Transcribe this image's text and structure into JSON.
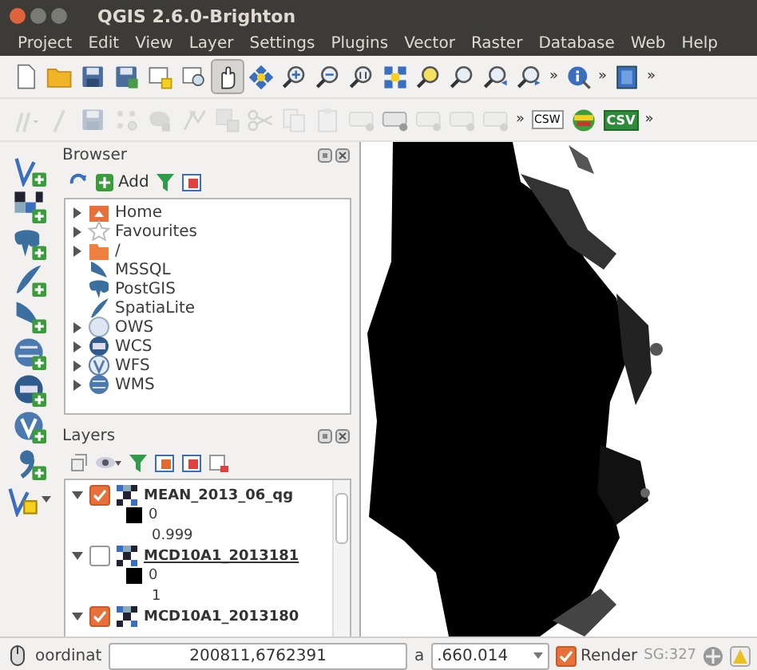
{
  "window": {
    "title": "QGIS 2.6.0-Brighton"
  },
  "menu": [
    "Project",
    "Edit",
    "View",
    "Layer",
    "Settings",
    "Plugins",
    "Vector",
    "Raster",
    "Database",
    "Web",
    "Help"
  ],
  "toolbar_1": [
    {
      "kind": "new",
      "pressed": false
    },
    {
      "kind": "open",
      "pressed": false
    },
    {
      "kind": "save",
      "pressed": false
    },
    {
      "kind": "saveas",
      "pressed": false
    },
    {
      "kind": "composer",
      "pressed": false
    },
    {
      "kind": "composer-manager",
      "pressed": false
    },
    {
      "kind": "pan",
      "pressed": true
    },
    {
      "kind": "pan-selection",
      "pressed": false
    },
    {
      "kind": "zoom-in",
      "pressed": false
    },
    {
      "kind": "zoom-out",
      "pressed": false
    },
    {
      "kind": "zoom-native",
      "pressed": false
    },
    {
      "kind": "zoom-full",
      "pressed": false
    },
    {
      "kind": "zoom-layer",
      "pressed": false
    },
    {
      "kind": "zoom-selection",
      "pressed": false
    },
    {
      "kind": "zoom-last",
      "pressed": false
    },
    {
      "kind": "zoom-next",
      "pressed": false
    },
    {
      "kind": "more",
      "label": "»"
    },
    {
      "kind": "identify",
      "pressed": false
    },
    {
      "kind": "more",
      "label": "»"
    },
    {
      "kind": "help",
      "pressed": false
    },
    {
      "kind": "more",
      "label": "»"
    }
  ],
  "toolbar_2": [
    {
      "kind": "edits",
      "disabled": true
    },
    {
      "kind": "edit",
      "disabled": true
    },
    {
      "kind": "save",
      "disabled": true
    },
    {
      "kind": "add-point",
      "disabled": true
    },
    {
      "kind": "add-feature",
      "disabled": true
    },
    {
      "kind": "node",
      "disabled": true
    },
    {
      "kind": "delete",
      "disabled": true
    },
    {
      "kind": "cut",
      "disabled": true
    },
    {
      "kind": "copy",
      "disabled": true
    },
    {
      "kind": "paste",
      "disabled": true
    },
    {
      "kind": "label",
      "disabled": true
    },
    {
      "kind": "label",
      "disabled": false
    },
    {
      "kind": "label",
      "disabled": true
    },
    {
      "kind": "label",
      "disabled": true
    },
    {
      "kind": "label",
      "disabled": true
    },
    {
      "kind": "more",
      "label": "»"
    },
    {
      "kind": "csw",
      "label": "CSW",
      "disabled": false
    },
    {
      "kind": "plugin",
      "disabled": false
    },
    {
      "kind": "csv",
      "label": "CSV",
      "disabled": false
    },
    {
      "kind": "more",
      "label": "»"
    }
  ],
  "browser": {
    "title": "Browser",
    "add_label": "Add",
    "items": [
      {
        "label": "Home",
        "expandable": true
      },
      {
        "label": "Favourites",
        "expandable": true
      },
      {
        "label": "/",
        "expandable": true
      },
      {
        "label": "MSSQL",
        "expandable": false
      },
      {
        "label": "PostGIS",
        "expandable": false
      },
      {
        "label": "SpatiaLite",
        "expandable": false
      },
      {
        "label": "OWS",
        "expandable": true
      },
      {
        "label": "WCS",
        "expandable": true
      },
      {
        "label": "WFS",
        "expandable": true
      },
      {
        "label": "WMS",
        "expandable": true
      }
    ]
  },
  "layers": {
    "title": "Layers",
    "items": [
      {
        "name": "MEAN_2013_06_qg",
        "checked": true,
        "expanded": true,
        "selected": false,
        "legend": [
          {
            "kind": "swatch",
            "label": "0"
          },
          {
            "kind": "value",
            "label": "0.999"
          }
        ]
      },
      {
        "name": "MCD10A1_2013181",
        "checked": false,
        "expanded": true,
        "selected": true,
        "legend": [
          {
            "kind": "swatch",
            "label": "0"
          },
          {
            "kind": "value",
            "label": "1"
          }
        ]
      },
      {
        "name": "MCD10A1_2013180",
        "checked": true,
        "expanded": true,
        "selected": false
      }
    ]
  },
  "status_bar": {
    "coordinate_label": "oordinat",
    "coordinate": "200811,6762391",
    "scale_label": "a",
    "scale": ".660.014",
    "render_label": "Render",
    "render": true,
    "crs": "SG:327"
  }
}
